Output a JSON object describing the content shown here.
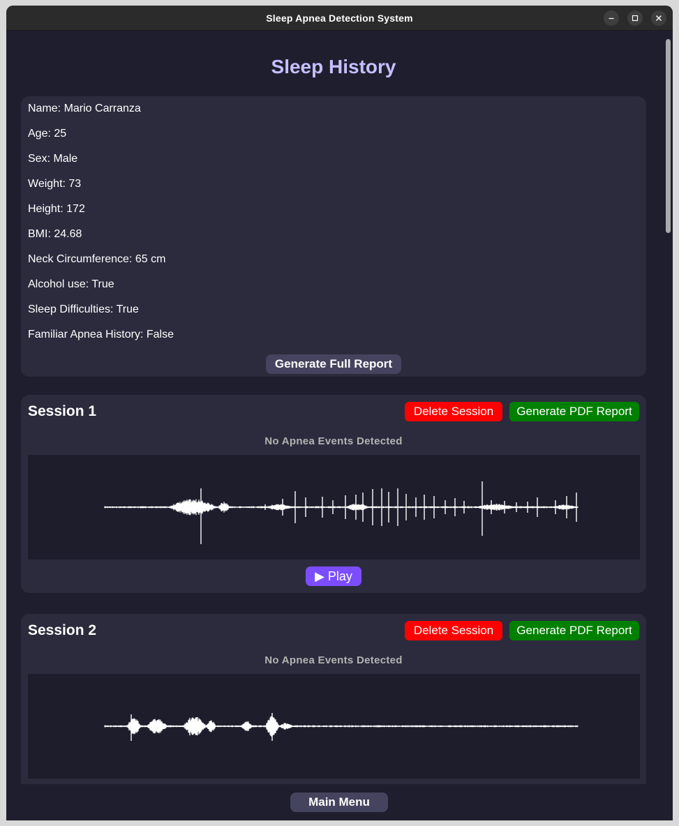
{
  "window": {
    "title": "Sleep Apnea Detection System"
  },
  "page": {
    "title": "Sleep History"
  },
  "patient": {
    "rows": [
      "Name: Mario Carranza",
      "Age: 25",
      "Sex: Male",
      "Weight: 73",
      "Height: 172",
      "BMI: 24.68",
      "Neck Circumference: 65 cm",
      "Alcohol use: True",
      "Sleep Difficulties: True",
      "Familiar Apnea History: False"
    ],
    "report_button": "Generate Full Report"
  },
  "sessions": [
    {
      "title": "Session 1",
      "delete_label": "Delete Session",
      "pdf_label": "Generate PDF Report",
      "events_label": "No Apnea Events Detected",
      "play_label": "▶ Play"
    },
    {
      "title": "Session 2",
      "delete_label": "Delete Session",
      "pdf_label": "Generate PDF Report",
      "events_label": "No Apnea Events Detected"
    }
  ],
  "footer": {
    "main_menu": "Main Menu"
  },
  "colors": {
    "window_bg": "#1f1e2e",
    "card_bg": "#2c2b3d",
    "title_accent": "#c4c0ff",
    "delete": "#ff0000",
    "pdf": "#008000",
    "play": "#7c4dff",
    "gray_button": "#44445e"
  },
  "icons": {
    "minimize": "minimize-icon",
    "maximize": "maximize-icon",
    "close": "close-icon"
  }
}
